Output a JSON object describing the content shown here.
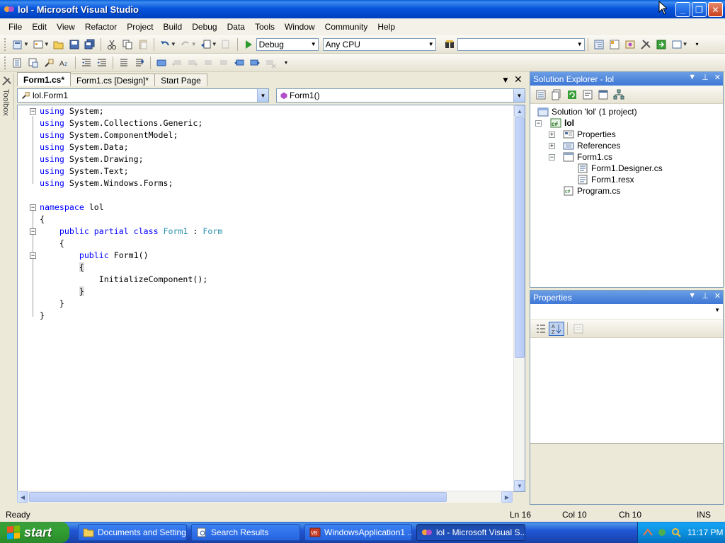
{
  "window": {
    "title": "lol - Microsoft Visual Studio",
    "buttons": [
      "minimize",
      "restore",
      "close"
    ]
  },
  "menu": [
    "File",
    "Edit",
    "View",
    "Refactor",
    "Project",
    "Build",
    "Debug",
    "Data",
    "Tools",
    "Window",
    "Community",
    "Help"
  ],
  "toolbar": {
    "config": "Debug",
    "platform": "Any CPU",
    "find_box": ""
  },
  "toolbox_label": "Toolbox",
  "editor": {
    "tabs": [
      {
        "label": "Form1.cs*",
        "active": true
      },
      {
        "label": "Form1.cs [Design]*",
        "active": false
      },
      {
        "label": "Start Page",
        "active": false
      }
    ],
    "type_combo": "lol.Form1",
    "member_combo": "Form1()",
    "code_lines": [
      "using System;",
      "using System.Collections.Generic;",
      "using System.ComponentModel;",
      "using System.Data;",
      "using System.Drawing;",
      "using System.Text;",
      "using System.Windows.Forms;",
      "",
      "namespace lol",
      "{",
      "    public partial class Form1 : Form",
      "    {",
      "        public Form1()",
      "        {",
      "            InitializeComponent();",
      "        }",
      "    }",
      "}"
    ]
  },
  "solution_explorer": {
    "title": "Solution Explorer - lol",
    "items": [
      {
        "label": "Solution 'lol' (1 project)",
        "level": 0,
        "icon": "solution-icon"
      },
      {
        "label": "lol",
        "level": 1,
        "icon": "csharp-project-icon",
        "bold": true
      },
      {
        "label": "Properties",
        "level": 2,
        "icon": "properties-folder-icon"
      },
      {
        "label": "References",
        "level": 2,
        "icon": "references-icon"
      },
      {
        "label": "Form1.cs",
        "level": 2,
        "icon": "form-icon"
      },
      {
        "label": "Form1.Designer.cs",
        "level": 3,
        "icon": "cs-file-icon"
      },
      {
        "label": "Form1.resx",
        "level": 3,
        "icon": "resx-file-icon"
      },
      {
        "label": "Program.cs",
        "level": 2,
        "icon": "cs-file-icon"
      }
    ]
  },
  "properties_panel": {
    "title": "Properties"
  },
  "statusbar": {
    "status": "Ready",
    "ln": "Ln 16",
    "col": "Col 10",
    "ch": "Ch 10",
    "mode": "INS"
  },
  "taskbar": {
    "start": "start",
    "tasks": [
      {
        "label": "Documents and Settings",
        "icon": "folder-icon",
        "active": false
      },
      {
        "label": "Search Results",
        "icon": "search-results-icon",
        "active": false
      },
      {
        "label": "WindowsApplication1 ...",
        "icon": "vs-icon",
        "active": false
      },
      {
        "label": "lol - Microsoft Visual S...",
        "icon": "vs-icon",
        "active": true
      }
    ],
    "clock": "11:17 PM"
  },
  "colors": {
    "keyword": "#0000ff",
    "type": "#2b91af",
    "titlebar": "#0855dd",
    "taskbar": "#2157d7",
    "start": "#33a033"
  }
}
